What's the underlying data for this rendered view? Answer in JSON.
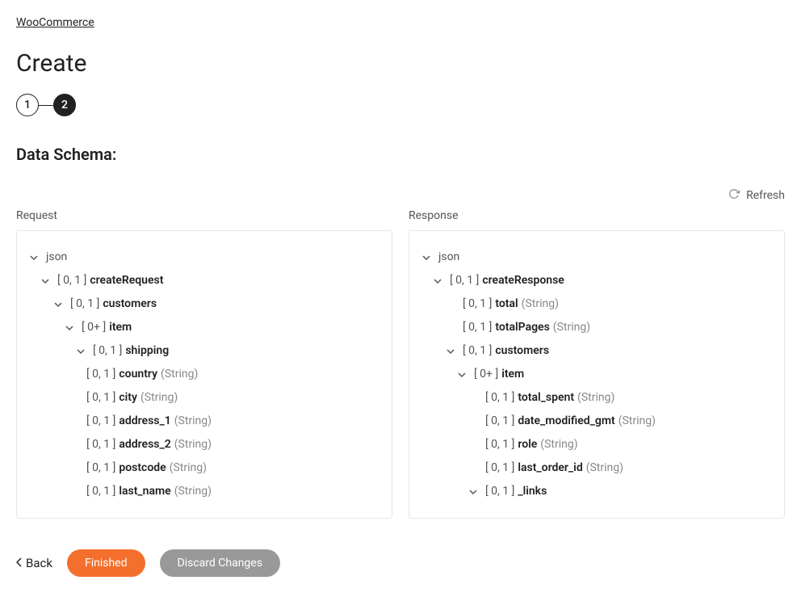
{
  "breadcrumb": "WooCommerce",
  "pageTitle": "Create",
  "stepper": {
    "step1": "1",
    "step2": "2"
  },
  "sectionTitle": "Data Schema:",
  "refreshLabel": "Refresh",
  "columns": {
    "request": "Request",
    "response": "Response"
  },
  "request": {
    "root": "json",
    "c01": "[ 0, 1 ]",
    "c0plus": "[ 0+ ]",
    "createRequest": "createRequest",
    "customers": "customers",
    "item": "item",
    "shipping": "shipping",
    "country": "country",
    "city": "city",
    "address_1": "address_1",
    "address_2": "address_2",
    "postcode": "postcode",
    "last_name": "last_name",
    "typeString": "(String)"
  },
  "response": {
    "root": "json",
    "c01": "[ 0, 1 ]",
    "c0plus": "[ 0+ ]",
    "createResponse": "createResponse",
    "total": "total",
    "totalPages": "totalPages",
    "customers": "customers",
    "item": "item",
    "total_spent": "total_spent",
    "date_modified_gmt": "date_modified_gmt",
    "role": "role",
    "last_order_id": "last_order_id",
    "_links": "_links",
    "typeString": "(String)"
  },
  "footer": {
    "back": "Back",
    "finished": "Finished",
    "discard": "Discard Changes"
  }
}
